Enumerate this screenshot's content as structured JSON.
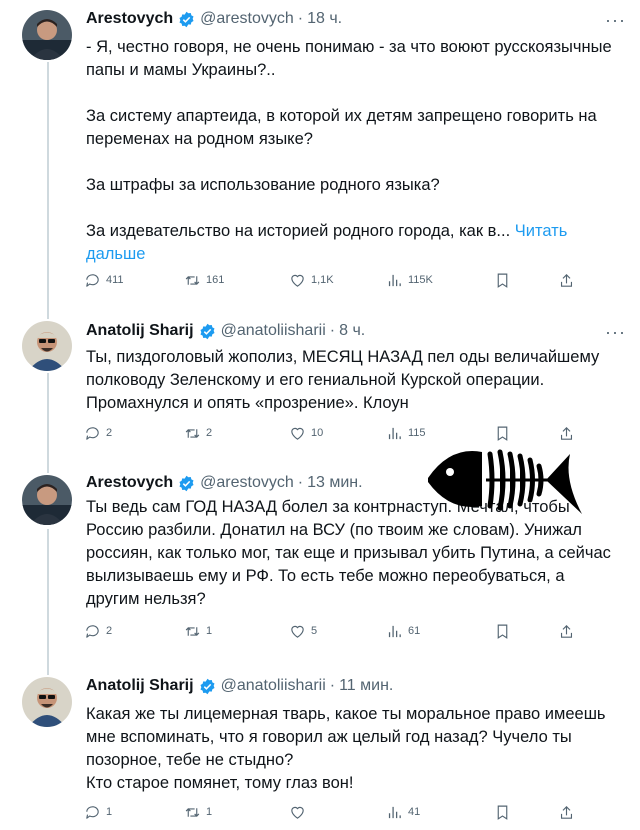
{
  "tweets": [
    {
      "name": "Arestovych",
      "handle": "@arestovych",
      "time": "18 ч.",
      "text": "- Я, честно говоря, не очень понимаю - за что воюют русскоязычные папы и мамы Украины?..\n\nЗа систему апартеида, в которой их детям запрещено говорить на переменах на родном языке?\n\nЗа штрафы за использование родного языка?\n\nЗа издевательство на историей родного города, как в...",
      "read_more": "Читать дальше",
      "stats": {
        "replies": "411",
        "retweets": "161",
        "likes": "1,1K",
        "views": "115K"
      }
    },
    {
      "name": "Anatolij Sharij",
      "handle": "@anatoliisharii",
      "time": "8 ч.",
      "text": "Ты, пиздоголовый жополиз, МЕСЯЦ НАЗАД пел оды величайшему полководу Зеленскому и его гениальной Курской операции. Промахнулся и опять «прозрение». Клоун",
      "stats": {
        "replies": "2",
        "retweets": "2",
        "likes": "10",
        "views": "115"
      }
    },
    {
      "name": "Arestovych",
      "handle": "@arestovych",
      "time": "13 мин.",
      "text": "Ты ведь сам ГОД НАЗАД болел за контрнаступ. Мечтал, чтобы Россию разбили. Донатил на ВСУ (по твоим же словам). Унижал россиян, как только мог, так еще и призывал убить Путина, а сейчас вылизываешь ему и РФ. То есть тебе можно переобуваться, а другим нельзя?",
      "stats": {
        "replies": "2",
        "retweets": "1",
        "likes": "5",
        "views": "61"
      }
    },
    {
      "name": "Anatolij Sharij",
      "handle": "@anatoliisharii",
      "time": "11 мин.",
      "text": "Какая же ты лицемерная тварь, какое ты моральное право имеешь мне вспоминать, что я говорил аж целый год назад? Чучело ты позорное, тебе не стыдно?\nКто старое помянет, тому глаз вон!",
      "stats": {
        "replies": "1",
        "retweets": "1",
        "likes": "",
        "views": "41"
      }
    }
  ],
  "separator": "·",
  "more_icon": "more-dots-icon",
  "colors": {
    "text": "#0f1419",
    "muted": "#536471",
    "link": "#1d9bf0",
    "verified": "#1d9bf0",
    "line": "#cfd9de"
  }
}
